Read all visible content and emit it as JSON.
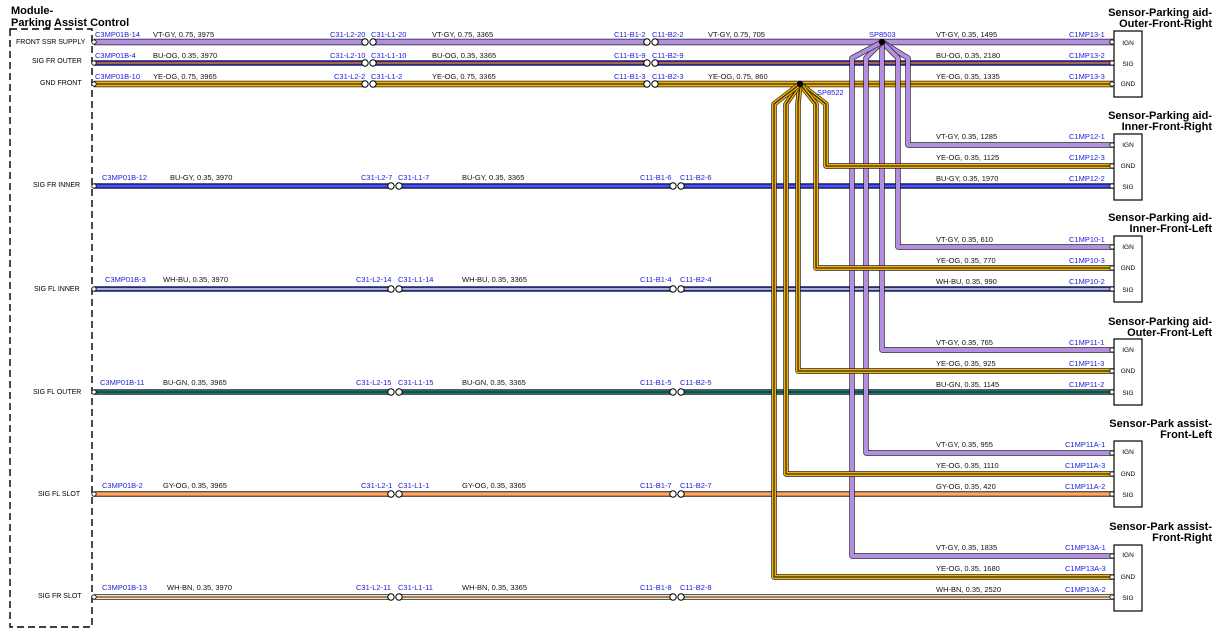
{
  "module": {
    "title_line1": "Module-",
    "title_line2": "Parking Assist Control",
    "signals": [
      "FRONT SSR SUPPLY",
      "SIG FR OUTER",
      "GND FRONT",
      "SIG FR INNER",
      "SIG FL INNER",
      "SIG FL OUTER",
      "SIG FL SLOT",
      "SIG FR SLOT"
    ]
  },
  "splices": {
    "sp1": "SP8503",
    "sp2": "SP8522"
  },
  "rows": [
    {
      "pin": "C3MP01B-14",
      "w1": "VT-GY,  0.75,  3975",
      "c1a": "C31-L2-20",
      "c1b": "C31-L1-20",
      "w2": "VT-GY,  0.75,  3365",
      "c2a": "C11-B1-2",
      "c2b": "C11-B2-2",
      "w3": "VT-GY,  0.75,  705"
    },
    {
      "pin": "C3MP01B-4",
      "w1": "BU-OG,  0.35,  3970",
      "c1a": "C31-L2-10",
      "c1b": "C31-L1-10",
      "w2": "BU-OG,  0.35,  3365",
      "c2a": "C11-B1-9",
      "c2b": "C11-B2-9",
      "w3": ""
    },
    {
      "pin": "C3MP01B-10",
      "w1": "YE-OG,  0.75,  3965",
      "c1a": "C31-L2-2",
      "c1b": "C31-L1-2",
      "w2": "YE-OG,  0.75,  3365",
      "c2a": "C11-B1-3",
      "c2b": "C11-B2-3",
      "w3": "YE-OG,  0.75,  860"
    },
    {
      "pin": "C3MP01B-12",
      "w1": "BU-GY,  0.35,  3970",
      "c1a": "C31-L2-7",
      "c1b": "C31-L1-7",
      "w2": "BU-GY,  0.35,  3365",
      "c2a": "C11-B1-6",
      "c2b": "C11-B2-6",
      "w3": ""
    },
    {
      "pin": "C3MP01B-3",
      "w1": "WH-BU,  0.35,  3970",
      "c1a": "C31-L2-14",
      "c1b": "C31-L1-14",
      "w2": "WH-BU,  0.35,  3365",
      "c2a": "C11-B1-4",
      "c2b": "C11-B2-4",
      "w3": ""
    },
    {
      "pin": "C3MP01B-11",
      "w1": "BU-GN,  0.35,  3965",
      "c1a": "C31-L2-15",
      "c1b": "C31-L1-15",
      "w2": "BU-GN,  0.35,  3365",
      "c2a": "C11-B1-5",
      "c2b": "C11-B2-5",
      "w3": ""
    },
    {
      "pin": "C3MP01B-2",
      "w1": "GY-OG,  0.35,  3965",
      "c1a": "C31-L2-1",
      "c1b": "C31-L1-1",
      "w2": "GY-OG,  0.35,  3365",
      "c2a": "C11-B1-7",
      "c2b": "C11-B2-7",
      "w3": ""
    },
    {
      "pin": "C3MP01B-13",
      "w1": "WH-BN,  0.35,  3970",
      "c1a": "C31-L2-11",
      "c1b": "C31-L1-11",
      "w2": "WH-BN,  0.35,  3365",
      "c2a": "C11-B1-8",
      "c2b": "C11-B2-8",
      "w3": ""
    }
  ],
  "sensors": [
    {
      "title1": "Sensor-Parking aid-",
      "title2": "Outer-Front-Right",
      "pins": [
        {
          "label": "IGN",
          "wire": "VT-GY,  0.35,  1495",
          "conn": "C1MP13-1"
        },
        {
          "label": "SIG",
          "wire": "BU-OG,  0.35,  2180",
          "conn": "C1MP13-2"
        },
        {
          "label": "GND",
          "wire": "YE-OG,  0.35,  1335",
          "conn": "C1MP13-3"
        }
      ]
    },
    {
      "title1": "Sensor-Parking aid-",
      "title2": "Inner-Front-Right",
      "pins": [
        {
          "label": "IGN",
          "wire": "VT-GY,  0.35,  1285",
          "conn": "C1MP12-1"
        },
        {
          "label": "GND",
          "wire": "YE-OG,  0.35,  1125",
          "conn": "C1MP12-3"
        },
        {
          "label": "SIG",
          "wire": "BU-GY,  0.35,  1970",
          "conn": "C1MP12-2"
        }
      ]
    },
    {
      "title1": "Sensor-Parking aid-",
      "title2": "Inner-Front-Left",
      "pins": [
        {
          "label": "IGN",
          "wire": "VT-GY,  0.35,  610",
          "conn": "C1MP10-1"
        },
        {
          "label": "GND",
          "wire": "YE-OG,  0.35,  770",
          "conn": "C1MP10-3"
        },
        {
          "label": "SIG",
          "wire": "WH-BU,  0.35,  990",
          "conn": "C1MP10-2"
        }
      ]
    },
    {
      "title1": "Sensor-Parking aid-",
      "title2": "Outer-Front-Left",
      "pins": [
        {
          "label": "IGN",
          "wire": "VT-GY,  0.35,  765",
          "conn": "C1MP11-1"
        },
        {
          "label": "GND",
          "wire": "YE-OG,  0.35,  925",
          "conn": "C1MP11-3"
        },
        {
          "label": "SIG",
          "wire": "BU-GN,  0.35,  1145",
          "conn": "C1MP11-2"
        }
      ]
    },
    {
      "title1": "Sensor-Park assist-",
      "title2": "Front-Left",
      "pins": [
        {
          "label": "IGN",
          "wire": "VT-GY,  0.35,  955",
          "conn": "C1MP11A-1"
        },
        {
          "label": "GND",
          "wire": "YE-OG,  0.35,  1110",
          "conn": "C1MP11A-3"
        },
        {
          "label": "SIG",
          "wire": "GY-OG,  0.35,  420",
          "conn": "C1MP11A-2"
        }
      ]
    },
    {
      "title1": "Sensor-Park assist-",
      "title2": "Front-Right",
      "pins": [
        {
          "label": "IGN",
          "wire": "VT-GY,  0.35,  1835",
          "conn": "C1MP13A-1"
        },
        {
          "label": "GND",
          "wire": "YE-OG,  0.35,  1680",
          "conn": "C1MP13A-3"
        },
        {
          "label": "SIG",
          "wire": "WH-BN,  0.35,  2520",
          "conn": "C1MP13A-2"
        }
      ]
    }
  ],
  "colors": {
    "vt_gy": "#b48ee0",
    "ye_og": "#f2b400",
    "blue": "#1f22c4",
    "bu_og_stripe": "#ff8a00",
    "bu_gn_stripe": "#26a836",
    "gy_og": "#e07a2e",
    "wh_bn": "#7a4b1a",
    "wh_bu_base": "#1e2a9a"
  }
}
